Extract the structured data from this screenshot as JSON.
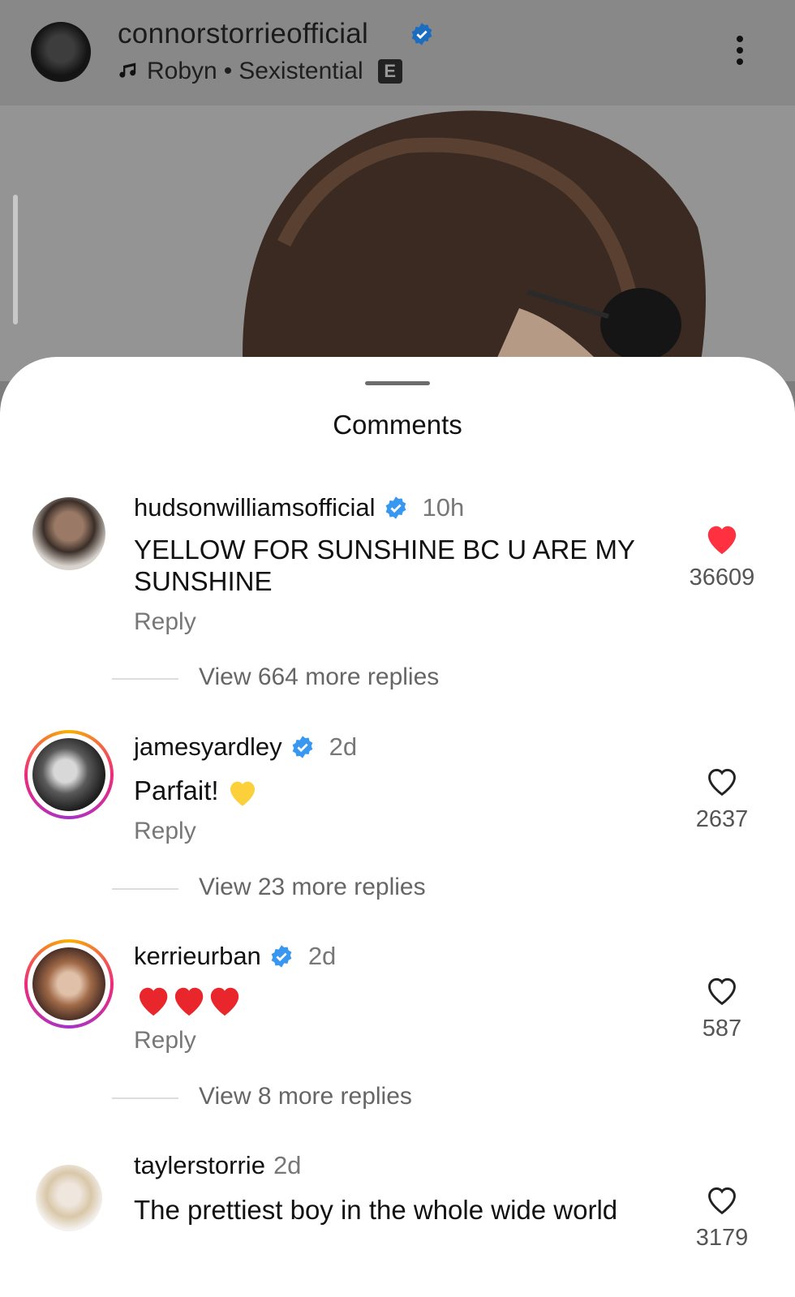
{
  "header": {
    "username": "connorstorrieofficial",
    "artist": "Robyn",
    "song": "Sexistential",
    "explicit_badge": "E",
    "verified_color": "#3897f0"
  },
  "sheet": {
    "title": "Comments"
  },
  "comments": [
    {
      "username": "hudsonwilliamsofficial",
      "verified": true,
      "time": "10h",
      "text": "YELLOW FOR SUNSHINE BC U ARE MY SUNSHINE",
      "reply_label": "Reply",
      "likes": "36609",
      "liked": true,
      "view_replies": "View 664 more replies"
    },
    {
      "username": "jamesyardley",
      "verified": true,
      "time": "2d",
      "text": "Parfait!",
      "emoji": "yellow-heart",
      "reply_label": "Reply",
      "likes": "2637",
      "liked": false,
      "view_replies": "View 23 more replies"
    },
    {
      "username": "kerrieurban",
      "verified": true,
      "time": "2d",
      "emoji": "red-heart-x3",
      "reply_label": "Reply",
      "likes": "587",
      "liked": false,
      "view_replies": "View 8 more replies"
    },
    {
      "username": "taylerstorrie",
      "verified": false,
      "time": "2d",
      "text": "The prettiest boy in the whole wide world",
      "likes": "3179",
      "liked": false
    }
  ],
  "colors": {
    "like_red": "#ff3040",
    "yellow_heart": "#fcd03a"
  }
}
